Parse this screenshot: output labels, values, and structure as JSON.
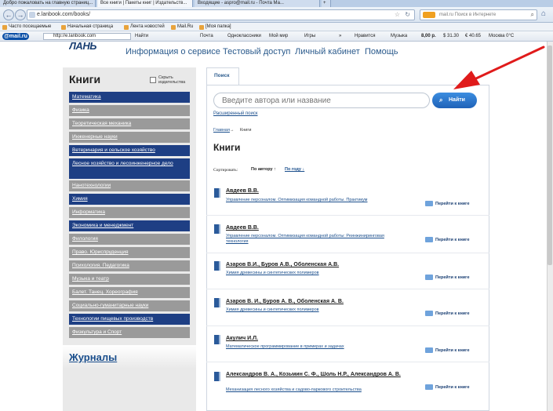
{
  "browser": {
    "tabs": [
      {
        "label": "Добро пожаловать на главную страниц...",
        "active": false
      },
      {
        "label": "Все книги | Пакеты книг | Издательств...",
        "active": true
      },
      {
        "label": "Входящие - aspro@mail.ru - Почта Ма...",
        "active": false
      }
    ],
    "new_tab": "+",
    "back": "←",
    "forward": "→",
    "url": "e.lanbook.com/books/",
    "search_placeholder": "mail.ru Поиск в Интернете",
    "home": "⌂"
  },
  "bookmarks": [
    "Часто посещаемые",
    "Начальная страница",
    "Лента новостей",
    "Mail.Ru",
    "[Моя папка]"
  ],
  "mailru_toolbar": {
    "brand": "@mail.ru",
    "url": "http://e.lanbook.com",
    "find": "Найти",
    "items": [
      "Почта",
      "Одноклассники",
      "Мой мир",
      "Игры",
      "»",
      "Нравится",
      "Музыка",
      "8,00 р.",
      "$ 31.30",
      "€ 40.65",
      "Москва 0°C"
    ]
  },
  "site": {
    "logo": "ЛАНЬ",
    "nav": [
      "Информация о сервисе",
      "Тестовый доступ",
      "Личный кабинет",
      "Помощь"
    ]
  },
  "sidebar": {
    "title": "Книги",
    "hide_publishers": "Скрыть издательства",
    "categories": [
      {
        "label": "Математика",
        "style": "blue"
      },
      {
        "label": "Физика",
        "style": "gray"
      },
      {
        "label": "Теоретическая механика",
        "style": "gray"
      },
      {
        "label": "Инженерные науки",
        "style": "gray"
      },
      {
        "label": "Ветеринария и сельское хозяйство",
        "style": "blue"
      },
      {
        "label": "Лесное хозяйство и лесоинженерное дело",
        "style": "blue"
      },
      {
        "label": "Нанотехнологии",
        "style": "gray"
      },
      {
        "label": "Химия",
        "style": "blue"
      },
      {
        "label": "Информатика",
        "style": "gray"
      },
      {
        "label": "Экономика и менеджмент",
        "style": "blue"
      },
      {
        "label": "Филология",
        "style": "gray"
      },
      {
        "label": "Право. Юриспруденция",
        "style": "gray"
      },
      {
        "label": "Психология. Педагогика",
        "style": "gray"
      },
      {
        "label": "Музыка и театр",
        "style": "gray"
      },
      {
        "label": "Балет. Танец. Хореография",
        "style": "gray"
      },
      {
        "label": "Социально-гуманитарные науки",
        "style": "gray"
      },
      {
        "label": "Технологии пищевых производств",
        "style": "blue"
      },
      {
        "label": "Физкультура и Спорт",
        "style": "gray"
      }
    ],
    "journals": "Журналы"
  },
  "main": {
    "search_tab": "Поиск",
    "search_placeholder": "Введите автора или название",
    "search_button": "Найти",
    "advanced_search": "Расширенный поиск",
    "breadcrumb": {
      "home": "Главная",
      "sep": "→",
      "current": "Книги"
    },
    "title": "Книги",
    "sort": {
      "label": "Сортировать:",
      "by_author": "По автору ↑",
      "by_year": "По году ↓"
    },
    "goto_label": "Перейти к книге",
    "books": [
      {
        "author": "Авдеев В.В.",
        "title": "Управление персоналом. Оптимизация командной работы. Практикум"
      },
      {
        "author": "Авдеев В.В.",
        "title": "Управление персоналом. Оптимизация командной работы: Реинжиниринговая технология"
      },
      {
        "author": "Азаров В.И., Буров А.В., Оболенская А.В.",
        "title": "Химия древесины и синтетических полимеров"
      },
      {
        "author": "Азаров В. И., Буров А. В., Оболенская А. В.",
        "title": "Химия древесины и синтетических полимеров"
      },
      {
        "author": "Акулич И.Л.",
        "title": "Математическое программирование в примерах и задачах"
      },
      {
        "author": "Александров В. А., Козьмин С. Ф., Шоль Н.Р., Александров А. В.",
        "title": "Механизация лесного хозяйства и садово-паркового строительства"
      }
    ]
  },
  "colors": {
    "nav_blue": "#2a5a8c",
    "category_blue": "#1e3f84",
    "category_gray": "#9a9a9a",
    "button_blue": "#1f62b8",
    "annotation_arrow": "#e01b1b"
  }
}
